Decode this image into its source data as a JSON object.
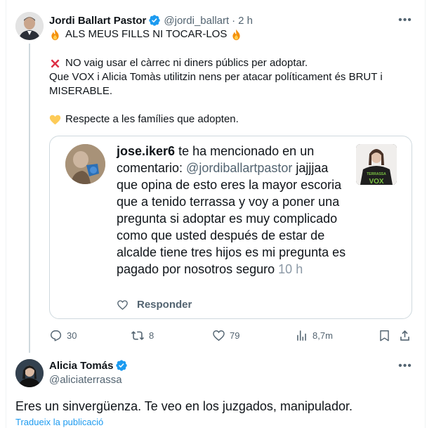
{
  "tweet": {
    "author_name": "Jordi Ballart Pastor",
    "author_handle": "@jordi_ballart",
    "separator": "·",
    "time": "2 h",
    "lines": [
      {
        "emoji": "fire",
        "text": "ALS MEUS FILLS NI TOCAR-LOS",
        "emoji_after": "fire"
      },
      {
        "emoji": "cross-mark",
        "text": "NO vaig usar el càrrec ni diners públics per adoptar."
      },
      {
        "text": "Que VOX i Alicia Tomàs utilitzin nens per atacar políticament és BRUT i"
      },
      {
        "text": "MISERABLE."
      },
      {
        "emoji": "yellow-heart",
        "text": "Respecte a les famílies que adopten."
      }
    ]
  },
  "quoted": {
    "username": "jose.iker6",
    "lead": " te ha mencionado en un comentario: ",
    "mention": "@jordiballartpastor",
    "body": " jajjjaa que opina de esto eres la mayor escoria que a tenido terrassa y voy a poner una pregunta si adoptar es muy complicado como que usted después de estar de alcalde tiene tres hijos es mi pregunta es pagado por nosotros seguro ",
    "ago": "10 h",
    "reply_label": "Responder",
    "thumb_text": "TERRASSA",
    "thumb_text2": "VOX"
  },
  "actions": {
    "replies": "30",
    "retweets": "8",
    "likes": "79",
    "views": "8,7m"
  },
  "reply": {
    "author_name": "Alicia Tomás",
    "author_handle": "@aliciaterrassa",
    "text": "Eres un sinvergüenza. Te veo en los juzgados, manipulador.",
    "translate_label": "Tradueix la publicació"
  },
  "colors": {
    "accent": "#1d9bf0",
    "muted": "#536471",
    "border": "#cfd9de"
  }
}
